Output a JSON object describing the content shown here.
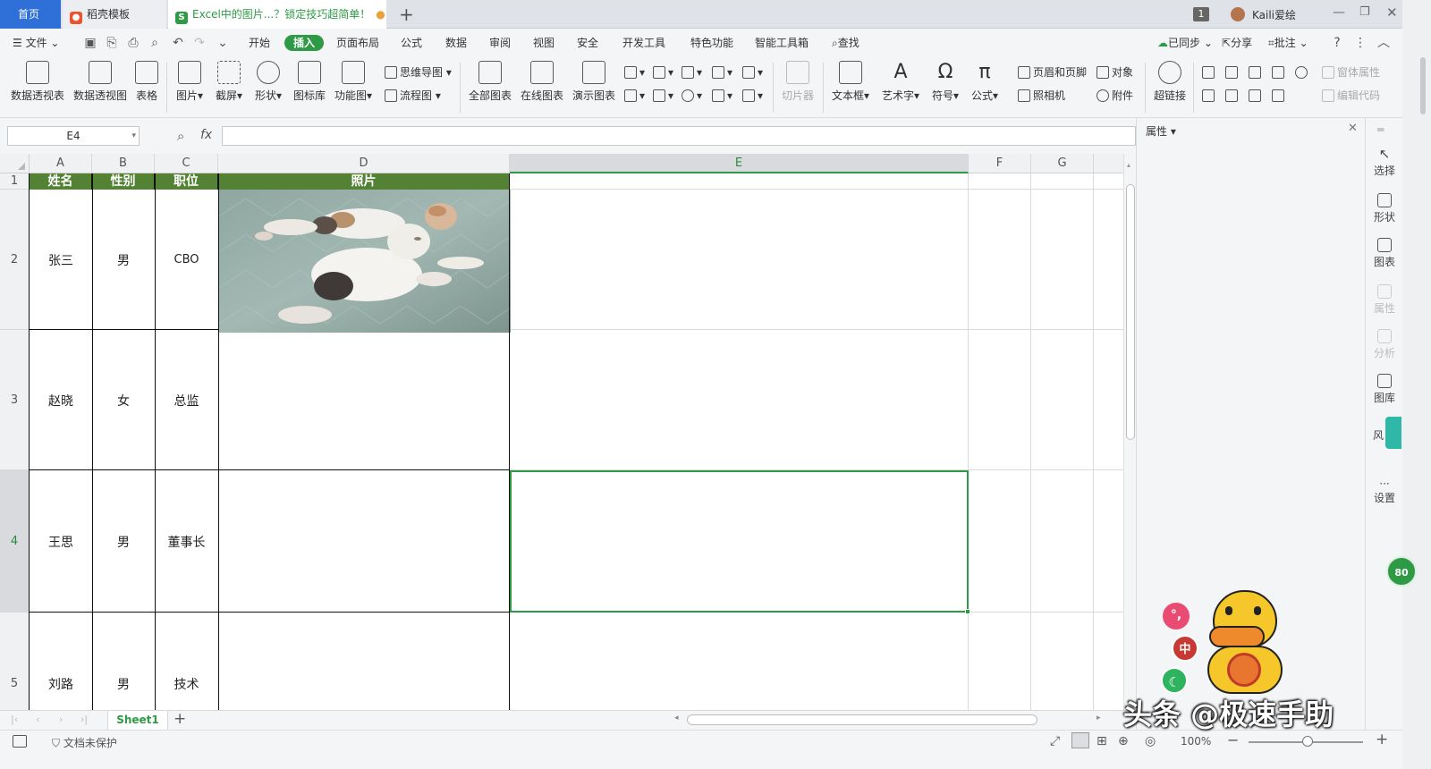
{
  "tabs": [
    {
      "label": "首页"
    },
    {
      "label": "稻壳模板"
    },
    {
      "label": "Excel中的图片...？锁定技巧超简单！"
    }
  ],
  "titlebar": {
    "badge": "1",
    "user": "Kaili爱绘"
  },
  "menu": {
    "file": "文件",
    "items": [
      "开始",
      "插入",
      "页面布局",
      "公式",
      "数据",
      "审阅",
      "视图",
      "安全",
      "开发工具",
      "特色功能",
      "智能工具箱"
    ],
    "search": "查找",
    "synced": "已同步",
    "share": "分享",
    "comment": "批注"
  },
  "ribbon": {
    "pivot_table": "数据透视表",
    "pivot_chart": "数据透视图",
    "table": "表格",
    "picture": "图片",
    "screenshot": "截屏",
    "shape": "形状",
    "icon_lib": "图标库",
    "func_chart": "功能图",
    "mindmap": "思维导图",
    "flowchart": "流程图",
    "all_charts": "全部图表",
    "online_chart": "在线图表",
    "demo_chart": "演示图表",
    "slicer": "切片器",
    "textbox": "文本框",
    "wordart": "艺术字",
    "symbol": "符号",
    "formula": "公式",
    "header_footer": "页眉和页脚",
    "camera": "照相机",
    "object": "对象",
    "attachment": "附件",
    "hyperlink": "超链接",
    "form_props": "窗体属性",
    "edit_code": "编辑代码"
  },
  "formula_bar": {
    "cell_ref": "E4",
    "fx": "fx",
    "content": ""
  },
  "columns": [
    "A",
    "B",
    "C",
    "D",
    "E",
    "F",
    "G"
  ],
  "rows": [
    "1",
    "2",
    "3",
    "4",
    "5"
  ],
  "table": {
    "headers": [
      "姓名",
      "性别",
      "职位",
      "照片"
    ],
    "rows": [
      {
        "name": "张三",
        "gender": "男",
        "position": "CBO"
      },
      {
        "name": "赵晓",
        "gender": "女",
        "position": "总监"
      },
      {
        "name": "王思",
        "gender": "男",
        "position": "董事长"
      },
      {
        "name": "刘路",
        "gender": "男",
        "position": "技术"
      }
    ]
  },
  "sheet": {
    "name": "Sheet1"
  },
  "status": {
    "protect": "文档未保护",
    "zoom": "100%"
  },
  "property_panel": {
    "title": "属性"
  },
  "sidebar": [
    "选择",
    "形状",
    "图表",
    "属性",
    "分析",
    "图库",
    "风",
    "设置"
  ],
  "float_badge": "80",
  "ime": {
    "mode": "中"
  },
  "watermark": "头条 @极速手助"
}
